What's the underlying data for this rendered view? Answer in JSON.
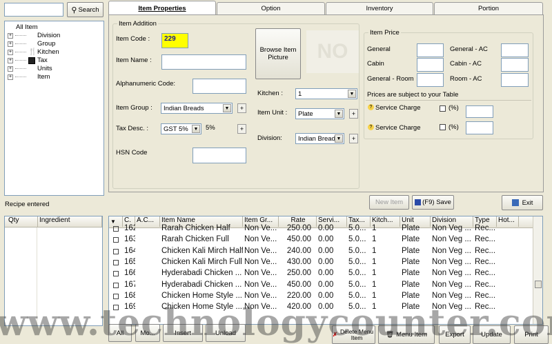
{
  "search": {
    "value": "",
    "button_label": "Search"
  },
  "tree": {
    "root": "All Item",
    "children": [
      "Division",
      "Group",
      "Kitchen",
      "Tax",
      "Units",
      "Item"
    ]
  },
  "tabs": [
    "Item Properties",
    "Option",
    "Inventory",
    "Portion"
  ],
  "item_addition": {
    "title": "Item Addition",
    "item_code_label": "Item Code :",
    "item_code": "229",
    "item_name_label": "Item Name :",
    "item_name": "",
    "alpha_label": "Alphanumeric Code:",
    "alpha_value": "",
    "group_label": "Item Group :",
    "group_value": "Indian Breads",
    "tax_label": "Tax Desc. :",
    "tax_value": "GST 5%",
    "tax_percent": "5%",
    "hsn_label": "HSN Code",
    "hsn_value": "",
    "browse_label": "Browse Item Picture",
    "no_image": "NO",
    "kitchen_label": "Kitchen :",
    "kitchen_value": "1",
    "unit_label": "Item Unit :",
    "unit_value": "Plate",
    "division_label": "Division:",
    "division_value": "Indian Breads",
    "plus": "+"
  },
  "item_price": {
    "title": "Item Price",
    "general": "General",
    "general_ac": "General - AC",
    "cabin": "Cabin",
    "cabin_ac": "Cabin - AC",
    "general_room": "General - Room",
    "room_ac": "Room - AC",
    "note": "Prices are subject to your Table",
    "service_charge_1": "Service Charge",
    "service_charge_2": "Service Charge",
    "percent": "(%)",
    "help_glyph": "?"
  },
  "recipe_label": "Recipe entered",
  "recipe_cols": [
    "Qty",
    "Ingredient"
  ],
  "buttons": {
    "new_item": "New Item",
    "save": "(F9) Save",
    "exit": "Exit"
  },
  "grid": {
    "columns": [
      "C.",
      "A.C...",
      "Item Name",
      "Item Gr...",
      "Rate",
      "Servi...",
      "Tax...",
      "Kitch...",
      "Unit",
      "Division",
      "Type",
      "Hot..."
    ],
    "rows": [
      [
        "162",
        "",
        "Rarah Chicken Half",
        "Non Ve...",
        "250.00",
        "0.00",
        "5.0...",
        "1",
        "Plate",
        "Non Veg ...",
        "Rec..."
      ],
      [
        "163",
        "",
        "Rarah Chicken Full",
        "Non Ve...",
        "450.00",
        "0.00",
        "5.0...",
        "1",
        "Plate",
        "Non Veg ...",
        "Rec..."
      ],
      [
        "164",
        "",
        "Chicken Kali Mirch Half",
        "Non Ve...",
        "240.00",
        "0.00",
        "5.0...",
        "1",
        "Plate",
        "Non Veg ...",
        "Rec..."
      ],
      [
        "165",
        "",
        "Chicken Kali Mirch Full",
        "Non Ve...",
        "430.00",
        "0.00",
        "5.0...",
        "1",
        "Plate",
        "Non Veg ...",
        "Rec..."
      ],
      [
        "166",
        "",
        "Hyderabadi Chicken ...",
        "Non Ve...",
        "250.00",
        "0.00",
        "5.0...",
        "1",
        "Plate",
        "Non Veg ...",
        "Rec..."
      ],
      [
        "167",
        "",
        "Hyderabadi Chicken ...",
        "Non Ve...",
        "450.00",
        "0.00",
        "5.0...",
        "1",
        "Plate",
        "Non Veg ...",
        "Rec..."
      ],
      [
        "168",
        "",
        "Chicken Home Style ...",
        "Non Ve...",
        "220.00",
        "0.00",
        "5.0...",
        "1",
        "Plate",
        "Non Veg ...",
        "Rec..."
      ],
      [
        "169",
        "",
        "Chicken Home Style ...",
        "Non Ve...",
        "420.00",
        "0.00",
        "5.0...",
        "1",
        "Plate",
        "Non Veg ...",
        "Rec..."
      ]
    ]
  },
  "bottom_buttons": [
    "All",
    "Mo...",
    "Insert",
    "Unload",
    "Delete Menu Item",
    "Menu Item",
    "Export",
    "Update",
    "Print"
  ],
  "watermark": "www.technologycounter.com"
}
